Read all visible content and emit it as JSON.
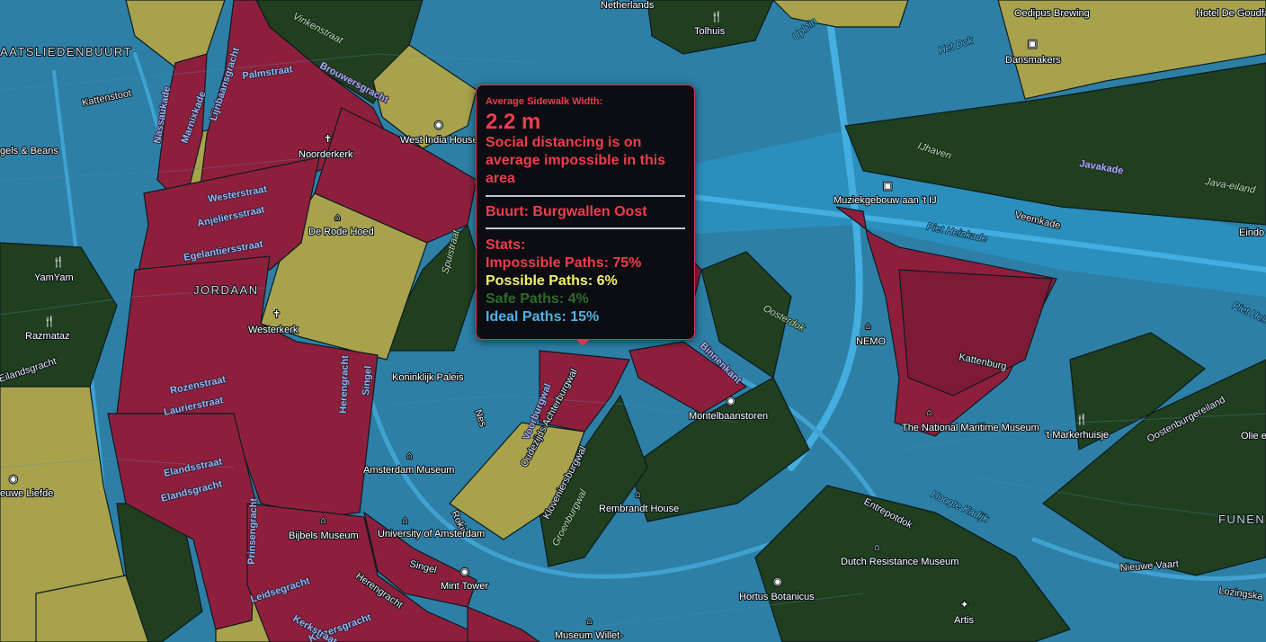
{
  "colors": {
    "impossible": "#8e1f3c",
    "possible": "#a8a24c",
    "safe": "#1f3f1f",
    "ideal": "#2d7fa6",
    "water": "#2b97c9",
    "tooltip_border": "#d23a4f"
  },
  "tooltip": {
    "heading": "Average Sidewalk Width:",
    "value": "2.2 m",
    "message": "Social distancing is on average impossible in this area",
    "buurt": "Buurt: Burgwallen Oost",
    "stats_title": "Stats:",
    "impossible": "Impossible Paths: 75%",
    "possible": "Possible Paths: 6%",
    "safe": "Safe Paths: 4%",
    "ideal": "Ideal Paths: 15%"
  },
  "labels": {
    "areas": [
      "AATSLIEDENBUURT",
      "JORDAAN",
      "FUNENI"
    ],
    "streets": [
      "Palmstraat",
      "Marnixkade",
      "Lijnbaansgracht",
      "Westerstraat",
      "Anjeliersstraat",
      "Egelantiersstraat",
      "Rozenstraat",
      "Laurierstraat",
      "Elandsstraat",
      "Elandsgracht",
      "Prinsengracht",
      "Herengracht",
      "Singel",
      "Leidsegracht",
      "Keizersgracht",
      "Kerkstraat",
      "Vinkenstraat",
      "Brouwersgracht",
      "Kattenstoot",
      "Nassaukade",
      "Spuistraat",
      "Voorburgwal",
      "Oudezijds Achterburgwal",
      "Kloveniersburgwal",
      "Groenburgwal",
      "Rokin",
      "Nes",
      "Binnenkant",
      "Oosterdok",
      "Kattenburg",
      "IJhaven",
      "Javakade",
      "Java-eiland",
      "Veemkade",
      "Piet Heinkade",
      "Het Dok",
      "Uplein",
      "Entrepotdok",
      "Hoogte Kadijk",
      "Oostenburgereiland",
      "Nieuwe Vaart",
      "Lozingska",
      "Piet Hein",
      "Eilandsgracht",
      "Herengracht",
      "Singel"
    ],
    "pois": [
      "Netherlands",
      "Tolhuis",
      "Oedipus Brewing",
      "Hotel De Goudfazant",
      "Dansmakers",
      "West India House",
      "Noorderkerk",
      "De Rode Hoed",
      "Westerkerk",
      "Koninklijk Paleis",
      "Montelbaanstoren",
      "Muziekgebouw aan 't IJ",
      "NEMO",
      "The National Maritime Museum",
      "'t Markerhuisje",
      "Olie e",
      "Amsterdam Museum",
      "Rembrandt House",
      "University of Amsterdam",
      "Bijbels Museum",
      "Mint Tower",
      "Dutch Resistance Museum",
      "Hortus Botanicus",
      "Artis",
      "Museum Willet-",
      "YamYam",
      "Razmataz",
      "Eindo",
      "gels & Beans",
      "euwe Liefde"
    ]
  }
}
